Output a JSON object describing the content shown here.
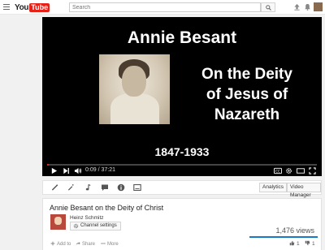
{
  "masthead": {
    "logo_you": "You",
    "logo_tube": "Tube",
    "search_placeholder": "Search"
  },
  "video": {
    "title_line": "Annie Besant",
    "subtitle_lines": [
      "On the Deity",
      "of Jesus of",
      "Nazareth"
    ],
    "years": "1847-1933",
    "time": "0:09 / 37:21",
    "progress": 0.004
  },
  "action_bar": {
    "analytics_label": "Analytics",
    "video_manager_label": "Video Manager"
  },
  "info": {
    "video_title": "Annie Besant on the Deity of Christ",
    "channel_name": "Heinz Schmitz",
    "channel_settings_label": "Channel settings",
    "views": "1,476 views",
    "add_to": "Add to",
    "share": "Share",
    "more": "More",
    "likes": "1",
    "dislikes": "1"
  },
  "colors": {
    "brand_red": "#e62117",
    "accent_blue": "#167ac6"
  }
}
